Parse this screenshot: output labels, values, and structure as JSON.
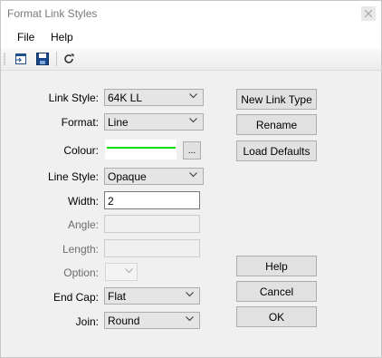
{
  "window": {
    "title": "Format Link Styles"
  },
  "menu": {
    "file": "File",
    "help": "Help"
  },
  "toolbar": {
    "icons": [
      "open-icon",
      "save-icon",
      "refresh-icon"
    ]
  },
  "form": {
    "link_style_label": "Link Style:",
    "link_style_value": "64K LL",
    "format_label": "Format:",
    "format_value": "Line",
    "colour_label": "Colour:",
    "colour_value": "#00e000",
    "colour_button": "...",
    "line_style_label": "Line Style:",
    "line_style_value": "Opaque",
    "width_label": "Width:",
    "width_value": "2",
    "angle_label": "Angle:",
    "angle_value": "",
    "length_label": "Length:",
    "length_value": "",
    "option_label": "Option:",
    "option_value": "",
    "end_cap_label": "End Cap:",
    "end_cap_value": "Flat",
    "join_label": "Join:",
    "join_value": "Round"
  },
  "buttons": {
    "new_link_type": "New Link Type",
    "rename": "Rename",
    "load_defaults": "Load Defaults",
    "help": "Help",
    "cancel": "Cancel",
    "ok": "OK"
  }
}
